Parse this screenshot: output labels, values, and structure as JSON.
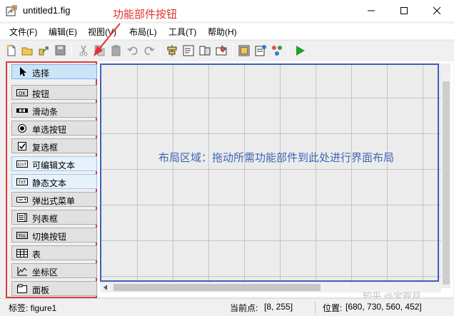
{
  "window": {
    "title": "untitled1.fig",
    "app_icon": "figure-icon",
    "controls": [
      "minimize-icon",
      "maximize-icon",
      "close-icon"
    ]
  },
  "annotation": {
    "label": "功能部件按钮",
    "color": "#e0332e"
  },
  "menu": {
    "items": [
      {
        "label": "文件(F)"
      },
      {
        "label": "编辑(E)"
      },
      {
        "label": "视图(V)"
      },
      {
        "label": "布局(L)"
      },
      {
        "label": "工具(T)"
      },
      {
        "label": "帮助(H)"
      }
    ]
  },
  "toolbar": {
    "buttons": [
      "new-icon",
      "open-icon",
      "export-icon",
      "save-icon",
      "cut-icon",
      "copy-icon",
      "paste-icon",
      "undo-icon",
      "redo-icon",
      "align-icon",
      "menu-editor-icon",
      "tab-order-icon",
      "toolbar-editor-icon",
      "editor-icon",
      "property-inspector-icon",
      "object-browser-icon",
      "run-icon"
    ]
  },
  "palette": {
    "items": [
      {
        "label": "选择",
        "icon": "select-arrow-icon",
        "state": "selected"
      },
      {
        "label": "按钮",
        "icon": "push-button-icon"
      },
      {
        "label": "滑动条",
        "icon": "slider-icon"
      },
      {
        "label": "单选按钮",
        "icon": "radio-button-icon"
      },
      {
        "label": "复选框",
        "icon": "checkbox-icon"
      },
      {
        "label": "可编辑文本",
        "icon": "edit-text-icon",
        "state": "highlighted",
        "icon_text": "EDIT"
      },
      {
        "label": "静态文本",
        "icon": "static-text-icon",
        "state": "highlighted",
        "icon_text": "TXT"
      },
      {
        "label": "弹出式菜单",
        "icon": "popup-menu-icon"
      },
      {
        "label": "列表框",
        "icon": "listbox-icon"
      },
      {
        "label": "切换按钮",
        "icon": "toggle-button-icon",
        "icon_text": "TGL"
      },
      {
        "label": "表",
        "icon": "table-icon"
      },
      {
        "label": "坐标区",
        "icon": "axes-icon"
      },
      {
        "label": "面板",
        "icon": "panel-icon"
      }
    ],
    "button_icon_text": "OK",
    "border_color": "#e03a3a",
    "selected_color": "#cce4f7"
  },
  "layout_area": {
    "text": "布局区域：拖动所需功能部件到此处进行界面布局",
    "border_color": "#3f5fb8",
    "text_color": "#3e65b4"
  },
  "status": {
    "tag_label": "标签: figure1",
    "current_point_label": "当前点:",
    "current_point_value": "[8, 255]",
    "position_label": "位置:",
    "position_value": "[680, 730, 560, 452]"
  },
  "watermark": "知乎 @宝观月"
}
